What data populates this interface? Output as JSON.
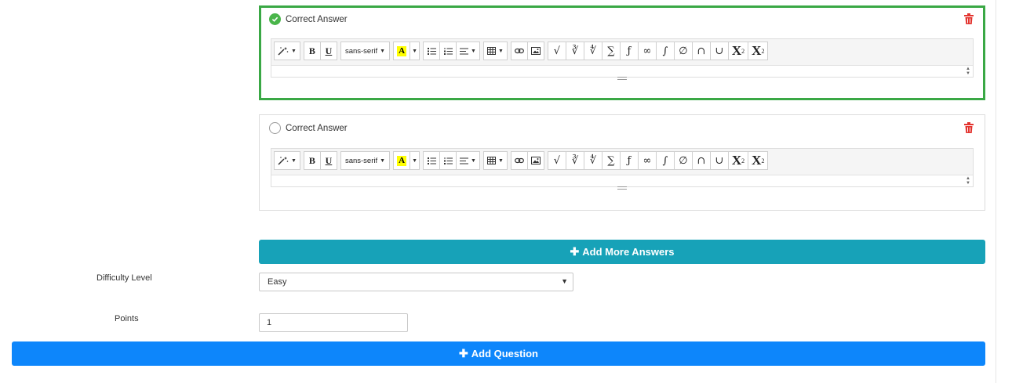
{
  "answers": [
    {
      "label": "Correct Answer",
      "checked": true
    },
    {
      "label": "Correct Answer",
      "checked": false
    }
  ],
  "toolbar": {
    "font_family": "sans-serif",
    "bold": "B",
    "underline": "U",
    "highlight": "A",
    "sqrt": "√",
    "cbrt": "∛",
    "fourth_root": "∜",
    "sum": "∑",
    "function": "ƒ",
    "infinity": "∞",
    "integral": "∫",
    "empty_set": "∅",
    "intersection": "∩",
    "union": "∪",
    "superscript_base": "X",
    "superscript_mark": "2",
    "subscript_base": "X",
    "subscript_mark": "2"
  },
  "add_more_label": "Add More Answers",
  "difficulty": {
    "label": "Difficulty Level",
    "value": "Easy"
  },
  "points": {
    "label": "Points",
    "value": "1"
  },
  "add_question_label": "Add Question",
  "colors": {
    "correct_border": "#3aa845",
    "add_more_bg": "#17a2b8",
    "add_question_bg": "#0d86fb",
    "trash": "#e3342f",
    "check": "#49b54a"
  },
  "icons": [
    "check-icon",
    "trash-icon",
    "magic-wand-icon",
    "unordered-list-icon",
    "ordered-list-icon",
    "align-icon",
    "table-icon",
    "link-icon",
    "image-icon",
    "plus-icon",
    "dropdown-arrow-icon"
  ]
}
